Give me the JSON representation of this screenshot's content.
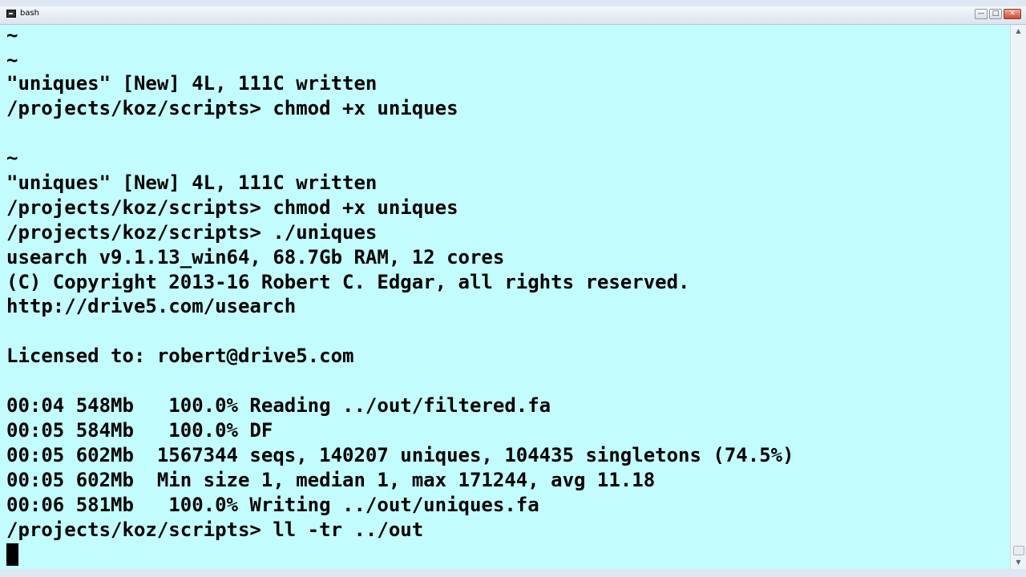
{
  "window": {
    "title": "bash",
    "controls": {
      "minimize": "—",
      "maximize": "□",
      "close": "✕"
    }
  },
  "terminal": {
    "background": "#c2fcfd",
    "lines": [
      "~",
      "~",
      "\"uniques\" [New] 4L, 111C written",
      "/projects/koz/scripts> chmod +x uniques",
      "",
      "~",
      "\"uniques\" [New] 4L, 111C written",
      "/projects/koz/scripts> chmod +x uniques",
      "/projects/koz/scripts> ./uniques",
      "usearch v9.1.13_win64, 68.7Gb RAM, 12 cores",
      "(C) Copyright 2013-16 Robert C. Edgar, all rights reserved.",
      "http://drive5.com/usearch",
      "",
      "Licensed to: robert@drive5.com",
      "",
      "00:04 548Mb   100.0% Reading ../out/filtered.fa",
      "00:05 584Mb   100.0% DF",
      "00:05 602Mb  1567344 seqs, 140207 uniques, 104435 singletons (74.5%)",
      "00:05 602Mb  Min size 1, median 1, max 171244, avg 11.18",
      "00:06 581Mb   100.0% Writing ../out/uniques.fa",
      "/projects/koz/scripts> ll -tr ../out"
    ]
  },
  "scrollbar": {
    "up_arrow": "▲",
    "down_arrow": "▼"
  }
}
